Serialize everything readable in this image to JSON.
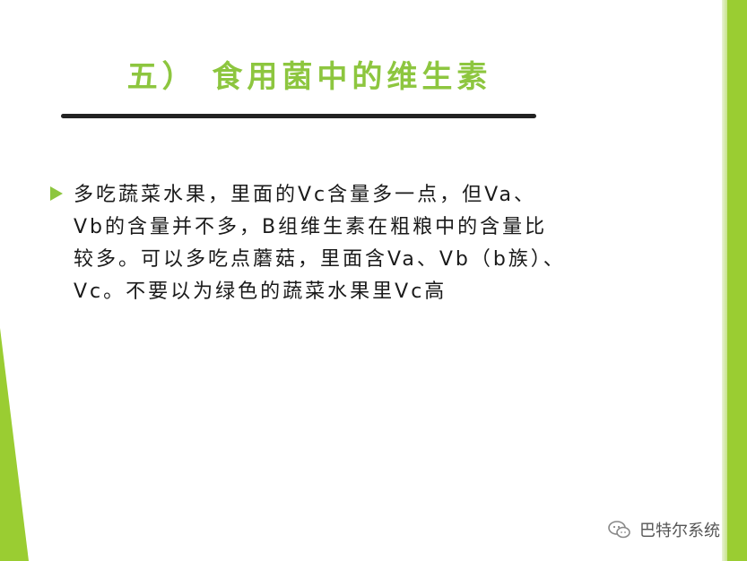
{
  "slide": {
    "title": "五） 食用菌中的维生素",
    "bullets": [
      "多吃蔬菜水果，里面的Vc含量多一点，但Va、\nVb的含量并不多，B组维生素在粗粮中的含量比\n较多。可以多吃点蘑菇，里面含Va、Vb（b族）、\nVc。不要以为绿色的蔬菜水果里Vc高"
    ]
  },
  "watermark": {
    "text": "巴特尔系统",
    "icon": "wechat-icon"
  },
  "colors": {
    "accent": "#9acd32",
    "title": "#8dc63f",
    "rule": "#222222",
    "text": "#1a1a1a"
  }
}
